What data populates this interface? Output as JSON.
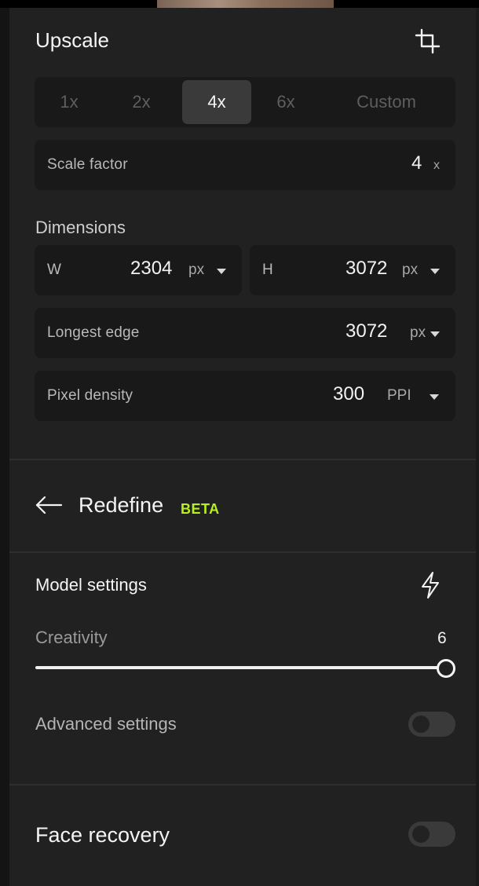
{
  "upscale": {
    "title": "Upscale",
    "crop_icon": "crop-icon",
    "scale_options": [
      "1x",
      "2x",
      "4x",
      "6x",
      "Custom"
    ],
    "selected_scale": "4x",
    "scale_factor": {
      "label": "Scale factor",
      "value": "4",
      "unit": "x"
    },
    "dimensions": {
      "label": "Dimensions",
      "width": {
        "label": "W",
        "value": "2304",
        "unit": "px"
      },
      "height": {
        "label": "H",
        "value": "3072",
        "unit": "px"
      }
    },
    "longest_edge": {
      "label": "Longest edge",
      "value": "3072",
      "unit": "px"
    },
    "pixel_density": {
      "label": "Pixel density",
      "value": "300",
      "unit": "PPI"
    }
  },
  "redefine": {
    "back_icon": "arrow-left-icon",
    "title": "Redefine",
    "badge": "BETA",
    "badge_color": "#b8f01e"
  },
  "model_settings": {
    "title": "Model settings",
    "icon": "lightning-icon",
    "creativity": {
      "label": "Creativity",
      "value": "6",
      "fraction": 1.0
    },
    "advanced": {
      "label": "Advanced settings",
      "enabled": false
    }
  },
  "face_recovery": {
    "label": "Face recovery",
    "enabled": false
  }
}
